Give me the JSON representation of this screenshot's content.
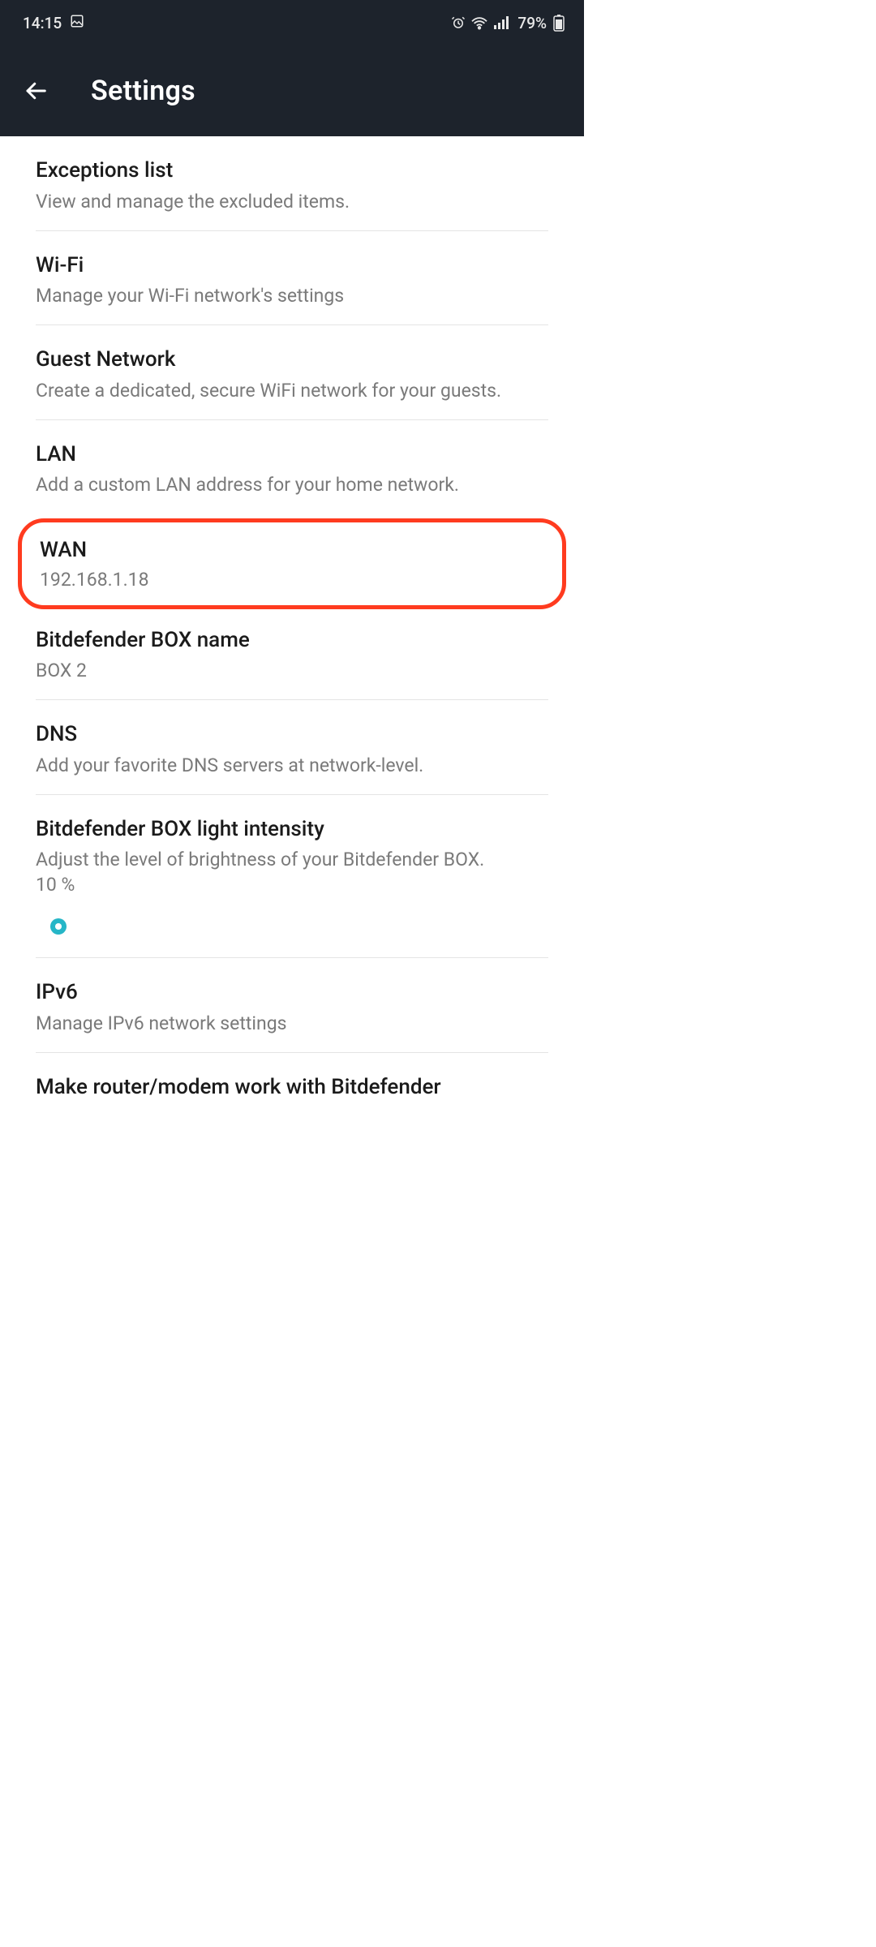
{
  "status": {
    "time": "14:15",
    "battery": "79%"
  },
  "header": {
    "title": "Settings"
  },
  "items": {
    "exceptions": {
      "title": "Exceptions list",
      "sub": "View and manage the excluded items."
    },
    "wifi": {
      "title": "Wi-Fi",
      "sub": "Manage your Wi-Fi network's settings"
    },
    "guest": {
      "title": "Guest Network",
      "sub": "Create a dedicated, secure WiFi network for your guests."
    },
    "lan": {
      "title": "LAN",
      "sub": "Add a custom LAN address for your home network."
    },
    "wan": {
      "title": "WAN",
      "sub": "192.168.1.18"
    },
    "boxname": {
      "title": "Bitdefender BOX name",
      "sub": "BOX 2"
    },
    "dns": {
      "title": "DNS",
      "sub": "Add your favorite DNS servers at network-level."
    },
    "light": {
      "title": "Bitdefender BOX light intensity",
      "sub": "Adjust the level of brightness of your Bitdefender BOX.",
      "value": "10 %"
    },
    "ipv6": {
      "title": "IPv6",
      "sub": "Manage IPv6 network settings"
    },
    "router": {
      "title": "Make router/modem work with Bitdefender"
    }
  }
}
